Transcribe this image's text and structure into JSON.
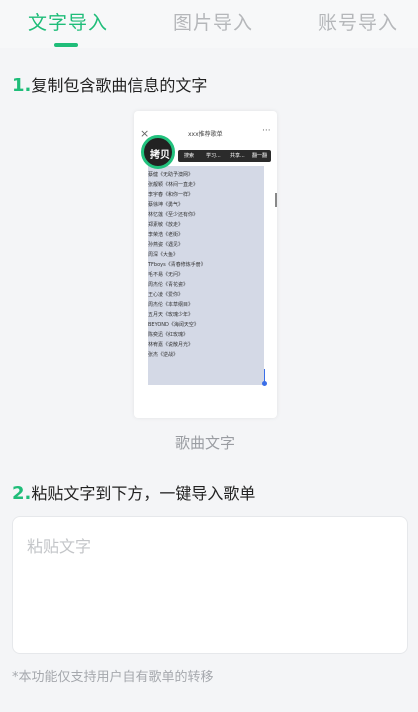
{
  "tabs": [
    {
      "label": "文字导入",
      "active": true
    },
    {
      "label": "图片导入",
      "active": false
    },
    {
      "label": "账号导入",
      "active": false
    }
  ],
  "accent_color": "#1fbd79",
  "step1": {
    "num": "1.",
    "text": "复制包含歌曲信息的文字"
  },
  "illustration": {
    "close": "×",
    "title": "xxx推荐歌单",
    "more": "···",
    "copy_label": "拷贝",
    "context_menu": [
      "搜索",
      "学习...",
      "共享...",
      "翻一翻"
    ],
    "songs": [
      "蔡健《无助予澳网》",
      "张靓颖《林间一直走》",
      "李宇春《和你一样》",
      "蔡徐坤《勇气》",
      "林忆莲《至少还有你》",
      "郑素敏《放走》",
      "李荣浩《老街》",
      "孙燕姿《遇见》",
      "周深《大鱼》",
      "TFboys《青春修炼手册》",
      "毛不易《无问》",
      "周杰伦《青花瓷》",
      "王心凌《爱你》",
      "周杰伦《本草纲目》",
      "五月天《玫瑰少年》",
      "BEYOND《海阔天空》",
      "陈奕迅《红玫瑰》",
      "林宥嘉《说散月光》",
      "张杰《逆战》"
    ],
    "caption": "歌曲文字"
  },
  "step2": {
    "num": "2.",
    "text": "粘贴文字到下方，一键导入歌单"
  },
  "input": {
    "placeholder": "粘贴文字"
  },
  "footnote": "*本功能仅支持用户自有歌单的转移"
}
